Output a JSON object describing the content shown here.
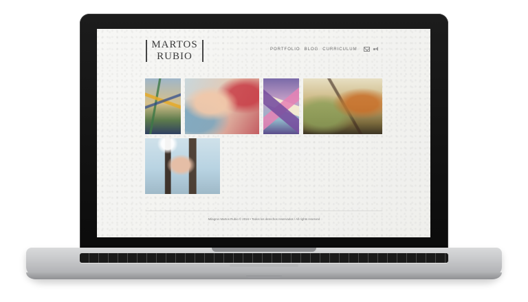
{
  "site": {
    "logo_line1": "MARTOS",
    "logo_line2": "RUBIO"
  },
  "nav": {
    "items": [
      "PORTFOLIO",
      "BLOG",
      "CURRICULUM"
    ]
  },
  "icons": {
    "mail": "mail-icon",
    "sound": "sound-icon"
  },
  "gallery": {
    "artworks": [
      {
        "name": "artwork-thumbnail-1",
        "dominant_colors": [
          "#9fb6c9",
          "#d6c08a",
          "#5c7a4c"
        ]
      },
      {
        "name": "artwork-thumbnail-2",
        "dominant_colors": [
          "#e6c9b2",
          "#c45d62",
          "#c8d7dc"
        ]
      },
      {
        "name": "artwork-thumbnail-3",
        "dominant_colors": [
          "#7a6aa8",
          "#c6a0c8",
          "#8fb6c8"
        ]
      },
      {
        "name": "artwork-thumbnail-4",
        "dominant_colors": [
          "#e7dfc3",
          "#c9b27a",
          "#7b6a3c"
        ]
      },
      {
        "name": "artwork-thumbnail-5",
        "dominant_colors": [
          "#cfe1ea",
          "#e6bea5",
          "#3a281c"
        ]
      }
    ]
  },
  "footer": {
    "text": "Milagros Martos Rubio © 2016 • Todos los derechos reservados / All rights reserved"
  },
  "colors": {
    "screen_bg": "#f3f3f1",
    "text": "#3a3a3a",
    "bezel": "#111111"
  }
}
